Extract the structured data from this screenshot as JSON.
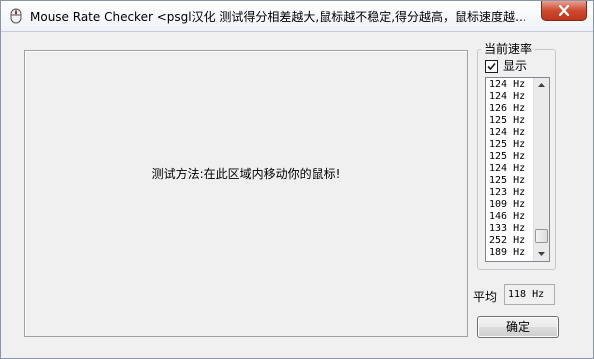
{
  "window": {
    "title": "Mouse Rate Checker <psgl汉化  测试得分相差越大,鼠标越不稳定,得分越高，鼠标速度越…"
  },
  "test_area": {
    "instruction": "测试方法:在此区域内移动你的鼠标!"
  },
  "rate_panel": {
    "legend": "当前速率",
    "show_label": "显示",
    "show_checked": true,
    "rates": [
      "124 Hz",
      "124 Hz",
      "126 Hz",
      "125 Hz",
      "124 Hz",
      "125 Hz",
      "125 Hz",
      "124 Hz",
      "125 Hz",
      "123 Hz",
      "109 Hz",
      "146 Hz",
      "133 Hz",
      "252 Hz",
      "189 Hz"
    ]
  },
  "average": {
    "label": "平均",
    "value": "118 Hz"
  },
  "buttons": {
    "ok_label": "确定"
  },
  "icons": {
    "app": "mouse-app-icon",
    "close": "close-icon",
    "check": "checkmark-icon",
    "scroll_up": "arrow-up-icon",
    "scroll_down": "arrow-down-icon"
  }
}
